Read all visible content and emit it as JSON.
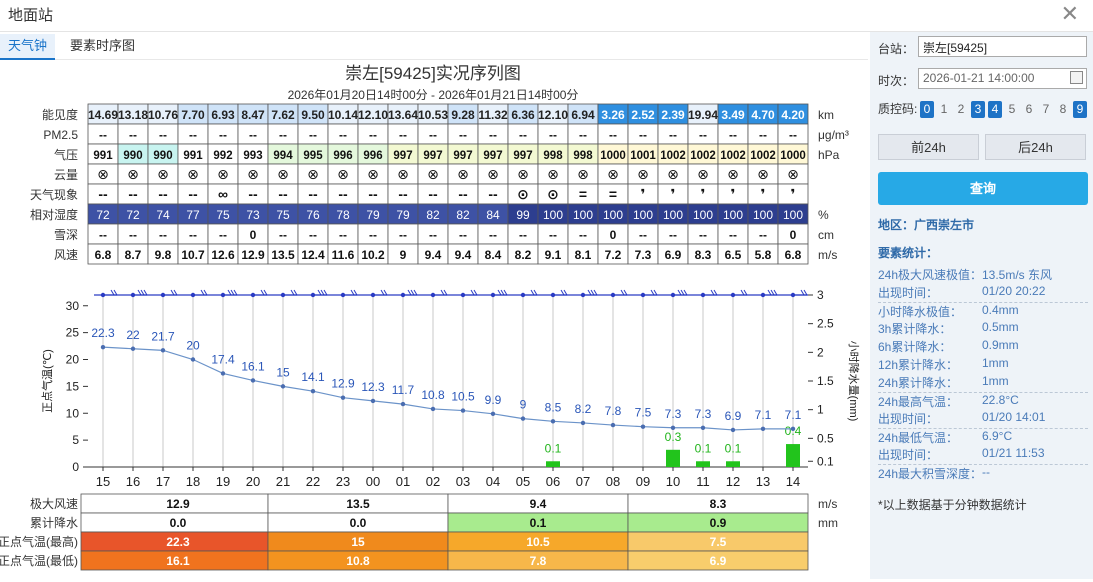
{
  "window": {
    "title": "地面站"
  },
  "tabs": [
    {
      "label": "天气钟",
      "active": true
    },
    {
      "label": "要素时序图",
      "active": false
    }
  ],
  "colors": {
    "accent": "#1e73c6",
    "query_button": "#27a9e6",
    "bar_green": "#22c41c",
    "temp_line": "#6b93c9",
    "rh_cell": "#3a4b9e"
  },
  "chart_data": {
    "type": "line",
    "title": "崇左[59425]实况序列图",
    "subtitle": "2026年01月20日14时00分 - 2026年01月21日14时00分",
    "hours": [
      "15",
      "16",
      "17",
      "18",
      "19",
      "20",
      "21",
      "22",
      "23",
      "00",
      "01",
      "02",
      "03",
      "04",
      "05",
      "06",
      "07",
      "08",
      "09",
      "10",
      "11",
      "12",
      "13",
      "14"
    ],
    "table": {
      "visibility": {
        "label": "能见度",
        "unit": "km",
        "values": [
          "14.69",
          "13.18",
          "10.76",
          "7.70",
          "6.93",
          "8.47",
          "7.62",
          "9.50",
          "10.14",
          "12.10",
          "13.64",
          "10.53",
          "9.28",
          "11.32",
          "6.36",
          "12.10",
          "6.94",
          "3.26",
          "2.52",
          "2.39",
          "19.94",
          "3.49",
          "4.70",
          "4.20"
        ]
      },
      "pm25": {
        "label": "PM2.5",
        "unit": "μg/m³",
        "values": [
          "--",
          "--",
          "--",
          "--",
          "--",
          "--",
          "--",
          "--",
          "--",
          "--",
          "--",
          "--",
          "--",
          "--",
          "--",
          "--",
          "--",
          "--",
          "--",
          "--",
          "--",
          "--",
          "--",
          "--"
        ]
      },
      "pressure": {
        "label": "气压",
        "unit": "hPa",
        "values": [
          "991",
          "990",
          "990",
          "991",
          "992",
          "993",
          "994",
          "995",
          "996",
          "996",
          "997",
          "997",
          "997",
          "997",
          "997",
          "998",
          "998",
          "1000",
          "1001",
          "1002",
          "1002",
          "1002",
          "1002",
          "1000"
        ]
      },
      "cloud": {
        "label": "云量",
        "unit": "",
        "values": [
          "⊗",
          "⊗",
          "⊗",
          "⊗",
          "⊗",
          "⊗",
          "⊗",
          "⊗",
          "⊗",
          "⊗",
          "⊗",
          "⊗",
          "⊗",
          "⊗",
          "⊗",
          "⊗",
          "⊗",
          "⊗",
          "⊗",
          "⊗",
          "⊗",
          "⊗",
          "⊗",
          "⊗"
        ]
      },
      "weather": {
        "label": "天气现象",
        "unit": "",
        "values": [
          "--",
          "--",
          "--",
          "--",
          "∞",
          "--",
          "--",
          "--",
          "--",
          "--",
          "--",
          "--",
          "--",
          "--",
          "⊙",
          "⊙",
          "=",
          "=",
          "❜",
          "❜",
          "❜",
          "❜",
          "❜",
          "❜"
        ]
      },
      "rh": {
        "label": "相对湿度",
        "unit": "%",
        "values": [
          "72",
          "72",
          "74",
          "77",
          "75",
          "73",
          "75",
          "76",
          "78",
          "79",
          "79",
          "82",
          "82",
          "84",
          "99",
          "100",
          "100",
          "100",
          "100",
          "100",
          "100",
          "100",
          "100",
          "100"
        ]
      },
      "snow": {
        "label": "雪深",
        "unit": "cm",
        "values": [
          "--",
          "--",
          "--",
          "--",
          "--",
          "0",
          "--",
          "--",
          "--",
          "--",
          "--",
          "--",
          "--",
          "--",
          "--",
          "--",
          "--",
          "0",
          "--",
          "--",
          "--",
          "--",
          "--",
          "0"
        ]
      },
      "wind": {
        "label": "风速",
        "unit": "m/s",
        "values": [
          "6.8",
          "8.7",
          "9.8",
          "10.7",
          "12.6",
          "12.9",
          "13.5",
          "12.4",
          "11.6",
          "10.2",
          "9",
          "9.4",
          "9.4",
          "8.4",
          "8.2",
          "9.1",
          "8.1",
          "7.2",
          "7.3",
          "6.9",
          "8.3",
          "6.5",
          "5.8",
          "6.8"
        ]
      }
    },
    "temperature": [
      22.3,
      22,
      21.7,
      20,
      17.4,
      16.1,
      15,
      14.1,
      12.9,
      12.3,
      11.7,
      10.8,
      10.5,
      9.9,
      9,
      8.5,
      8.2,
      7.8,
      7.5,
      7.3,
      7.3,
      6.9,
      7.1,
      7.1
    ],
    "precip_bars": [
      {
        "hour": "06",
        "value": 0.1
      },
      {
        "hour": "10",
        "value": 0.3
      },
      {
        "hour": "11",
        "value": 0.1
      },
      {
        "hour": "12",
        "value": 0.1
      },
      {
        "hour": "14",
        "value": 0.4
      }
    ],
    "y_left": {
      "label": "正点气温(℃)",
      "ticks": [
        "0",
        "5",
        "10",
        "15",
        "20",
        "25",
        "30"
      ],
      "ylim": [
        0,
        32
      ]
    },
    "y_right": {
      "label": "小时降水量(mm)",
      "ticks": [
        "0.1",
        "0.5",
        "1",
        "1.5",
        "2",
        "2.5",
        "3"
      ],
      "ylim": [
        0,
        3
      ]
    },
    "summary": {
      "rows": [
        {
          "label": "极大风速",
          "unit": "m/s",
          "cells": [
            "12.9",
            "13.5",
            "9.4",
            "8.3"
          ]
        },
        {
          "label": "累计降水",
          "unit": "mm",
          "cells": [
            "0.0",
            "0.0",
            "0.1",
            "0.9"
          ]
        },
        {
          "label": "正点气温(最高)",
          "unit": "",
          "cells": [
            "22.3",
            "15",
            "10.5",
            "7.5"
          ]
        },
        {
          "label": "正点气温(最低)",
          "unit": "",
          "cells": [
            "16.1",
            "10.8",
            "7.8",
            "6.9"
          ]
        }
      ]
    }
  },
  "side": {
    "station_label": "台站：",
    "station_value": "崇左[59425]",
    "time_label": "时次：",
    "time_value": "2026-01-21 14:00:00",
    "qc_label": "质控码:",
    "qc_codes": [
      {
        "n": "0",
        "on": true
      },
      {
        "n": "1",
        "on": false
      },
      {
        "n": "2",
        "on": false
      },
      {
        "n": "3",
        "on": true
      },
      {
        "n": "4",
        "on": true
      },
      {
        "n": "5",
        "on": false
      },
      {
        "n": "6",
        "on": false
      },
      {
        "n": "7",
        "on": false
      },
      {
        "n": "8",
        "on": false
      },
      {
        "n": "9",
        "on": true
      }
    ],
    "prev_btn": "前24h",
    "next_btn": "后24h",
    "query_btn": "查询",
    "region": "地区：广西崇左市",
    "stats_title": "要素统计：",
    "stats": [
      {
        "k": "24h极大风速极值：",
        "v": "13.5m/s 东风",
        "sep": false
      },
      {
        "k": "出现时间：",
        "v": "01/20 20:22",
        "sep": false
      },
      {
        "k": "小时降水极值：",
        "v": "0.4mm",
        "sep": true
      },
      {
        "k": "3h累计降水：",
        "v": "0.5mm",
        "sep": false
      },
      {
        "k": "6h累计降水：",
        "v": "0.9mm",
        "sep": false
      },
      {
        "k": "12h累计降水：",
        "v": "1mm",
        "sep": false
      },
      {
        "k": "24h累计降水：",
        "v": "1mm",
        "sep": false
      },
      {
        "k": "24h最高气温：",
        "v": "22.8°C",
        "sep": true
      },
      {
        "k": "出现时间：",
        "v": "01/20 14:01",
        "sep": false
      },
      {
        "k": "24h最低气温：",
        "v": "6.9°C",
        "sep": true
      },
      {
        "k": "出现时间：",
        "v": "01/21 11:53",
        "sep": false
      },
      {
        "k": "24h最大积雪深度：",
        "v": "--",
        "sep": true
      }
    ],
    "note": "*以上数据基于分钟数据统计"
  }
}
